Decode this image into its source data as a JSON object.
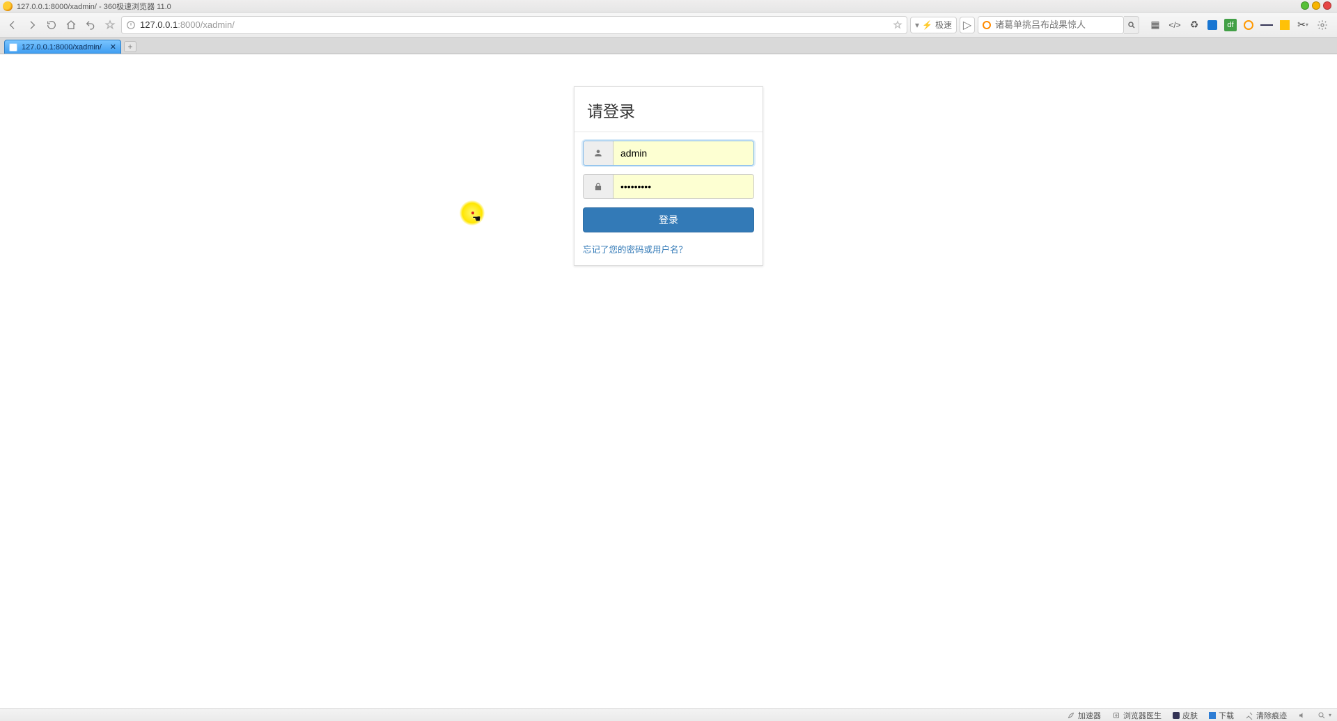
{
  "window": {
    "title": "127.0.0.1:8000/xadmin/ - 360极速浏览器 11.0"
  },
  "traffic_colors": {
    "green": "#57c038",
    "yellow": "#f7b500",
    "red": "#e64545"
  },
  "toolbar": {
    "address_host": "127.0.0.1",
    "address_port_path": ":8000/xadmin/",
    "mode_label": "极速",
    "search_placeholder": "诸葛单挑吕布战果惊人"
  },
  "tab": {
    "label": "127.0.0.1:8000/xadmin/"
  },
  "login": {
    "title": "请登录",
    "username_value": "admin",
    "password_value": "•••••••••",
    "submit_label": "登录",
    "forgot_label": "忘记了您的密码或用户名？"
  },
  "status": {
    "items": [
      "加速器",
      "浏览器医生",
      "皮肤",
      "下载",
      "清除痕迹"
    ]
  }
}
